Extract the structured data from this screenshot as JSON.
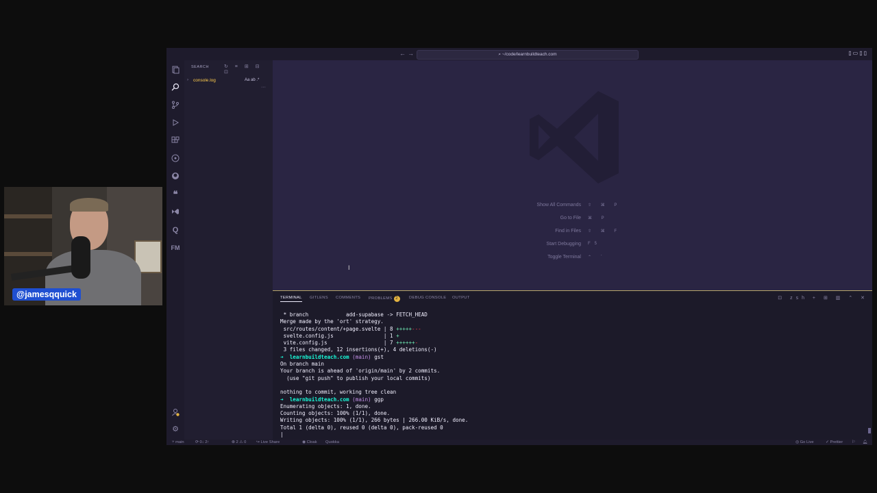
{
  "webcam": {
    "handle": "@jamesqquick"
  },
  "titlebar": {
    "back": "←",
    "forward": "→",
    "path": "~/code/learnbuildteach.com",
    "layout_icons": "▯▭▯▯"
  },
  "activity": [
    "explorer-icon",
    "search-icon",
    "source-control-icon",
    "run-debug-icon",
    "extensions-icon",
    "gitlens-icon",
    "github-icon",
    "quotes-icon",
    "vscode-icon",
    "quokka-icon",
    "fm-icon"
  ],
  "activity_bottom": [
    "accounts-icon",
    "settings-gear-icon"
  ],
  "sidebar": {
    "title": "SEARCH",
    "tools": "↻ ≡ ⊞ ⊟ ⊡",
    "query": "console.log",
    "query_opts": "Aa ab .*",
    "more": "···"
  },
  "editor": {
    "hints": [
      {
        "label": "Show All Commands",
        "keys": "⇧ ⌘ P"
      },
      {
        "label": "Go to File",
        "keys": "⌘ P"
      },
      {
        "label": "Find in Files",
        "keys": "⇧ ⌘ F"
      },
      {
        "label": "Start Debugging",
        "keys": "F5"
      },
      {
        "label": "Toggle Terminal",
        "keys": "⌃ `"
      }
    ]
  },
  "panel": {
    "tabs": [
      "TERMINAL",
      "GITLENS",
      "COMMENTS",
      "PROBLEMS",
      "DEBUG CONSOLE",
      "OUTPUT"
    ],
    "problems_count": "2",
    "tools": "⊡ zsh + ⊞ ▥ ⌃ ✕"
  },
  "terminal": {
    "lines": [
      {
        "t": " * branch            add-supabase -> FETCH_HEAD"
      },
      {
        "t": "Merge made by the 'ort' strategy."
      },
      {
        "t": " src/routes/content/+page.svelte | 8 ",
        "plus": "+++++",
        "minus": "---"
      },
      {
        "t": " svelte.config.js                | 1 ",
        "plus": "+"
      },
      {
        "t": " vite.config.js                  | 7 ",
        "plus": "++++++",
        "minus": "-"
      },
      {
        "t": " 3 files changed, 12 insertions(+), 4 deletions(-)"
      },
      {
        "prompt": true,
        "repo": "learnbuildteach.com",
        "branch": "(main)",
        "cmd": "gst"
      },
      {
        "t": "On branch main"
      },
      {
        "t": "Your branch is ahead of 'origin/main' by 2 commits."
      },
      {
        "t": "  (use \"git push\" to publish your local commits)"
      },
      {
        "t": ""
      },
      {
        "t": "nothing to commit, working tree clean"
      },
      {
        "prompt": true,
        "repo": "learnbuildteach.com",
        "branch": "(main)",
        "cmd": "ggp"
      },
      {
        "t": "Enumerating objects: 1, done."
      },
      {
        "t": "Counting objects: 100% (1/1), done."
      },
      {
        "t": "Writing objects: 100% (1/1), 266 bytes | 266.00 KiB/s, done."
      },
      {
        "t": "Total 1 (delta 0), reused 0 (delta 0), pack-reused 0"
      },
      {
        "t": "|"
      }
    ]
  },
  "statusbar": {
    "branch": "main",
    "sync": "0↓ 2↑",
    "errors": "⊗ 2 ⚠ 0",
    "liveshare": "Live Share",
    "cloak": "Cloak",
    "quokka": "Quokka",
    "golive": "Go Live",
    "prettier": "Prettier"
  },
  "colors": {
    "accent": "#19f9d8",
    "editor_bg": "#2a2543",
    "panel_bg": "#1c1a29",
    "badge": "#e3b341"
  }
}
